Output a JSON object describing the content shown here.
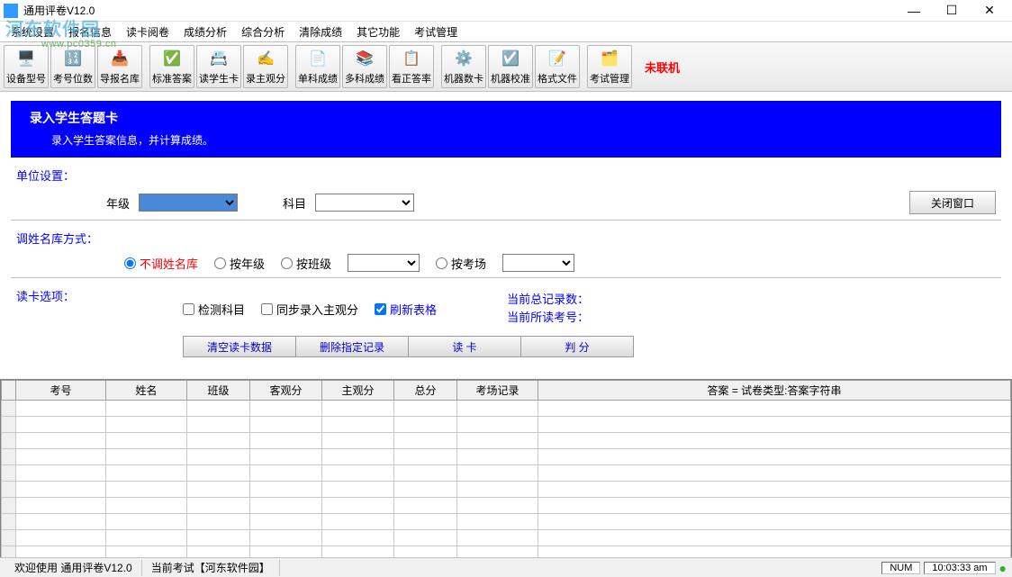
{
  "window": {
    "title": "通用评卷V12.0",
    "minimize": "—",
    "maximize": "☐",
    "close": "✕"
  },
  "menu": {
    "items": [
      "系统设置",
      "报名信息",
      "读卡阅卷",
      "成绩分析",
      "综合分析",
      "清除成绩",
      "其它功能",
      "考试管理"
    ]
  },
  "watermark": {
    "text": "河东软件园",
    "url": "www.pc0359.cn"
  },
  "toolbar": {
    "items": [
      {
        "label": "设备型号",
        "icon": "🖥️"
      },
      {
        "label": "考号位数",
        "icon": "🔢"
      },
      {
        "label": "导报名库",
        "icon": "📥"
      },
      {
        "label": "标准答案",
        "icon": "✅"
      },
      {
        "label": "读学生卡",
        "icon": "📇"
      },
      {
        "label": "录主观分",
        "icon": "✍️"
      },
      {
        "label": "单科成绩",
        "icon": "📄"
      },
      {
        "label": "多科成绩",
        "icon": "📚"
      },
      {
        "label": "看正答率",
        "icon": "📋"
      },
      {
        "label": "机器数卡",
        "icon": "⚙️"
      },
      {
        "label": "机器校准",
        "icon": "☑️"
      },
      {
        "label": "格式文件",
        "icon": "📝"
      },
      {
        "label": "考试管理",
        "icon": "🗂️"
      }
    ],
    "connection": "未联机"
  },
  "banner": {
    "title": "录入学生答题卡",
    "desc": "录入学生答案信息，并计算成绩。"
  },
  "unit_section": {
    "label": "单位设置：",
    "grade_label": "年级",
    "grade_value": "",
    "subject_label": "科目",
    "subject_value": "",
    "close_btn": "关闭窗口"
  },
  "namelib_section": {
    "label": "调姓名库方式：",
    "options": {
      "no_lookup": "不调姓名库",
      "by_grade": "按年级",
      "by_class": "按班级",
      "by_room": "按考场"
    }
  },
  "readcard_section": {
    "label": "读卡选项：",
    "checks": {
      "detect_subject": "检测科目",
      "sync_subjective": "同步录入主观分",
      "refresh_grid": "刷新表格"
    },
    "info": {
      "total_label": "当前总记录数：",
      "current_label": "当前所读考号："
    },
    "buttons": {
      "clear": "清空读卡数据",
      "delete": "删除指定记录",
      "read": "读  卡",
      "judge": "判  分"
    }
  },
  "grid": {
    "columns": [
      "考号",
      "姓名",
      "班级",
      "客观分",
      "主观分",
      "总分",
      "考场记录",
      "答案 = 试卷类型:答案字符串"
    ]
  },
  "statusbar": {
    "welcome": "欢迎使用  通用评卷V12.0",
    "current_exam": "当前考试【河东软件园】",
    "num": "NUM",
    "time": "10:03:33 am"
  }
}
